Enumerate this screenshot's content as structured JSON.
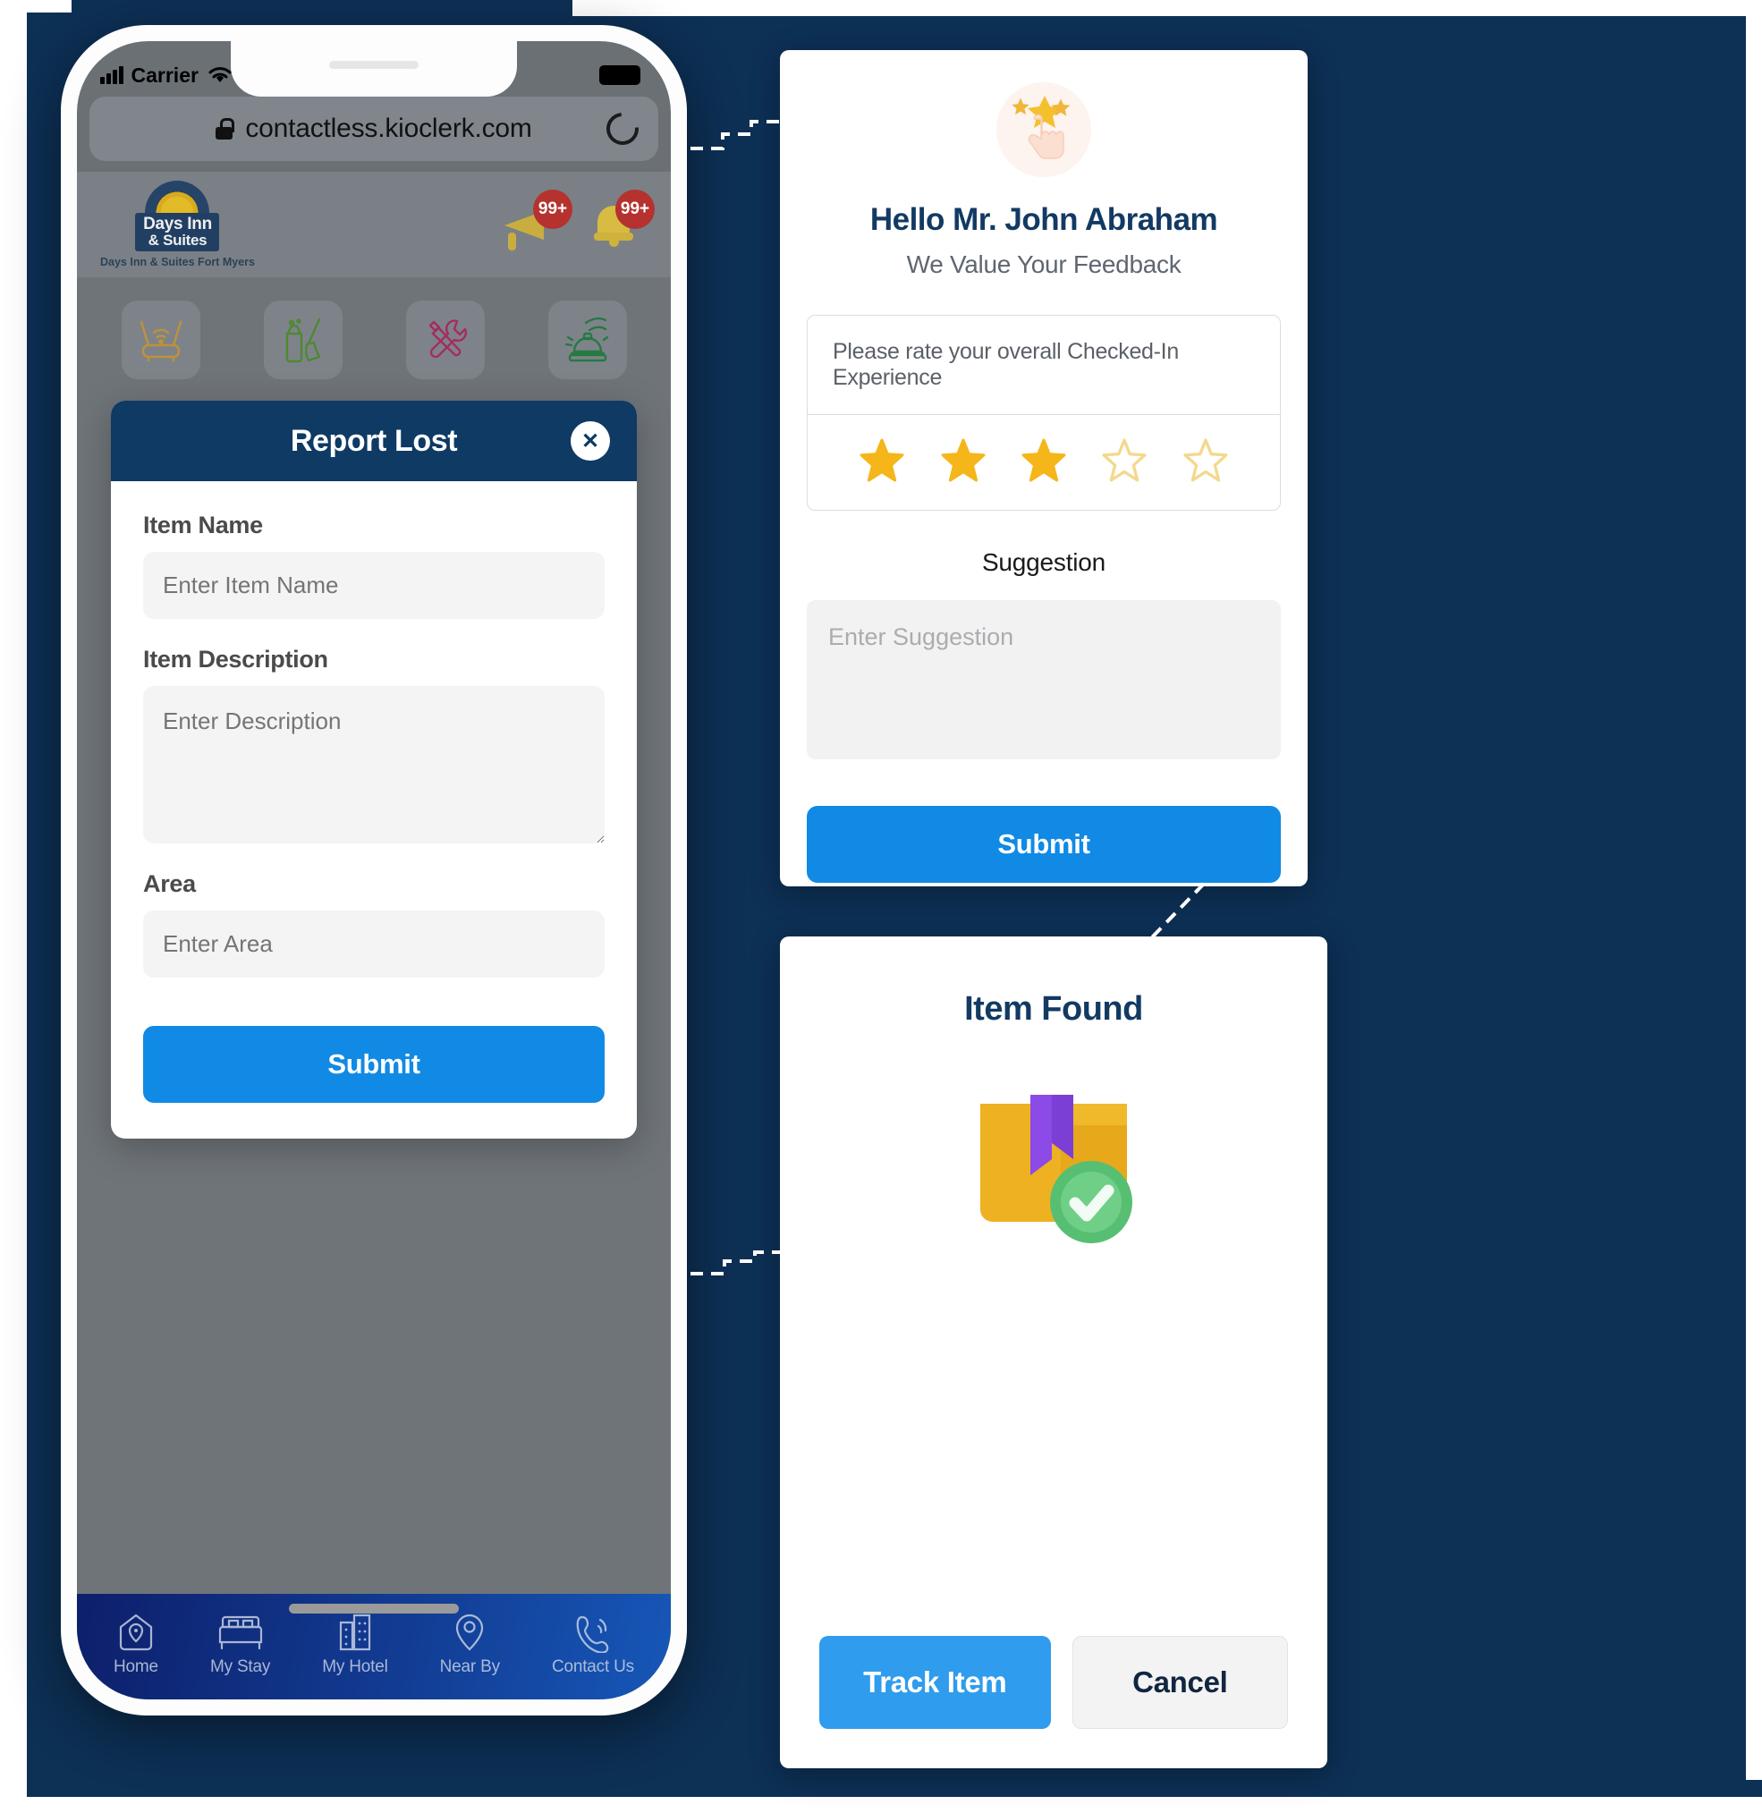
{
  "phone": {
    "status_bar": {
      "carrier": "Carrier",
      "wifi_icon": "wifi-icon",
      "battery_icon": "battery-icon",
      "signal_icon": "signal-bars-icon"
    },
    "browser": {
      "url": "contactless.kioclerk.com",
      "lock_icon": "lock-icon",
      "reload_icon": "reload-icon"
    },
    "hotel_header": {
      "logo_line1": "Days Inn",
      "logo_line2": "& Suites",
      "logo_caption": "Days Inn & Suites Fort Myers",
      "notifications": [
        {
          "icon": "megaphone-icon",
          "badge": "99+"
        },
        {
          "icon": "bell-icon",
          "badge": "99+"
        }
      ]
    },
    "services": [
      {
        "icon": "wifi-router-icon",
        "color": "#c49434"
      },
      {
        "icon": "housekeeping-broom-icon",
        "color": "#4a8a2a"
      },
      {
        "icon": "maintenance-tools-icon",
        "color": "#a8265a"
      },
      {
        "icon": "service-bell-icon",
        "color": "#1e7a3c"
      }
    ],
    "modal": {
      "title": "Report Lost",
      "close_icon": "close-icon",
      "fields": [
        {
          "label": "Item Name",
          "placeholder": "Enter Item Name",
          "value": "",
          "type": "text"
        },
        {
          "label": "Item Description",
          "placeholder": "Enter Description",
          "value": "",
          "type": "textarea"
        },
        {
          "label": "Area",
          "placeholder": "Enter Area",
          "value": "",
          "type": "text"
        }
      ],
      "submit_label": "Submit"
    },
    "bottom_nav": [
      {
        "label": "Home",
        "icon": "home-pin-icon"
      },
      {
        "label": "My Stay",
        "icon": "bed-icon"
      },
      {
        "label": "My Hotel",
        "icon": "building-icon"
      },
      {
        "label": "Near By",
        "icon": "location-pin-icon"
      },
      {
        "label": "Contact Us",
        "icon": "phone-call-icon"
      }
    ]
  },
  "feedback_card": {
    "icon": "hand-tap-stars-icon",
    "greeting": "Hello Mr. John Abraham",
    "subtitle": "We Value Your Feedback",
    "rating_question": "Please rate your overall Checked-In Experience",
    "rating_value": 3,
    "rating_max": 5,
    "star_filled_color": "#f5b61a",
    "star_empty_color": "#f3d98d",
    "suggestion_label": "Suggestion",
    "suggestion_placeholder": "Enter Suggestion",
    "suggestion_value": "",
    "submit_label": "Submit"
  },
  "item_found_card": {
    "title": "Item Found",
    "icon": "package-check-icon",
    "track_label": "Track Item",
    "cancel_label": "Cancel"
  },
  "theme": {
    "background": "#0d3055",
    "primary_blue": "#108ae5",
    "navy": "#0e3a63",
    "badge_red": "#b5322f"
  }
}
